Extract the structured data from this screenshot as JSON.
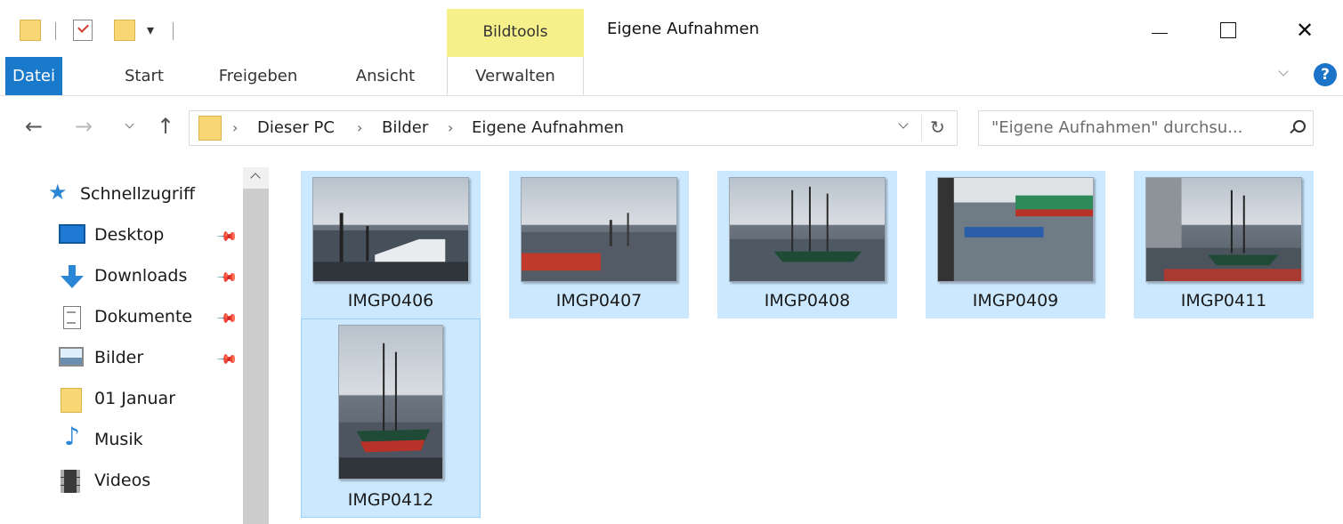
{
  "window": {
    "title": "Eigene Aufnahmen",
    "contextual_group": "Bildtools",
    "minimize_glyph": "—",
    "close_glyph": "✕"
  },
  "quick_access_toolbar": {
    "dropdown_glyph": "▾",
    "icons": [
      "folder-icon",
      "properties-check-icon",
      "new-folder-icon"
    ]
  },
  "ribbon": {
    "tabs": [
      {
        "label": "Datei",
        "active": true
      },
      {
        "label": "Start"
      },
      {
        "label": "Freigeben"
      },
      {
        "label": "Ansicht"
      },
      {
        "label": "Verwalten"
      }
    ],
    "help_glyph": "?"
  },
  "navigation": {
    "back_glyph": "←",
    "forward_glyph": "→",
    "up_glyph": "↑",
    "refresh_glyph": "↻",
    "breadcrumb": [
      "Dieser PC",
      "Bilder",
      "Eigene Aufnahmen"
    ],
    "crumb_separator": "›"
  },
  "search": {
    "placeholder": "\"Eigene Aufnahmen\" durchsu..."
  },
  "sidebar": {
    "pin_glyph": "📌",
    "items": [
      {
        "label": "Schnellzugriff",
        "icon": "quick-access-star-icon",
        "pinned": false
      },
      {
        "label": "Desktop",
        "icon": "desktop-icon",
        "pinned": true
      },
      {
        "label": "Downloads",
        "icon": "download-arrow-icon",
        "pinned": true
      },
      {
        "label": "Dokumente",
        "icon": "document-icon",
        "pinned": true
      },
      {
        "label": "Bilder",
        "icon": "pictures-icon",
        "pinned": true
      },
      {
        "label": "01 Januar",
        "icon": "folder-icon",
        "pinned": false
      },
      {
        "label": "Musik",
        "icon": "music-note-icon",
        "pinned": false
      },
      {
        "label": "Videos",
        "icon": "video-film-icon",
        "pinned": false
      }
    ],
    "star_glyph": "★",
    "music_glyph": "♪"
  },
  "files": [
    {
      "name": "IMGP0406",
      "selected": true,
      "orientation": "landscape"
    },
    {
      "name": "IMGP0407",
      "selected": true,
      "orientation": "landscape"
    },
    {
      "name": "IMGP0408",
      "selected": true,
      "orientation": "landscape"
    },
    {
      "name": "IMGP0409",
      "selected": true,
      "orientation": "landscape"
    },
    {
      "name": "IMGP0411",
      "selected": true,
      "orientation": "landscape"
    },
    {
      "name": "IMGP0412",
      "selected": true,
      "orientation": "portrait",
      "focused": true
    }
  ],
  "colors": {
    "file_tab": "#1979ca",
    "contextual_tab": "#f5f08a",
    "selection": "#cce8ff",
    "focus_border": "#99d1ff",
    "accent_blue": "#2b86d6"
  }
}
